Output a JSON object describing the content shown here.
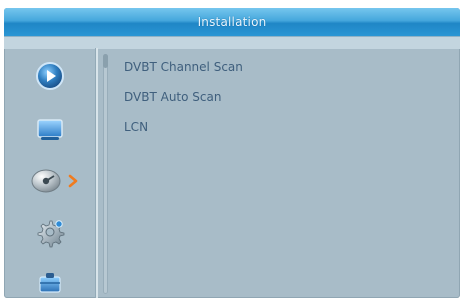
{
  "title": "Installation",
  "sidebar": {
    "items": [
      {
        "icon": "media-play-icon"
      },
      {
        "icon": "tv-monitor-icon"
      },
      {
        "icon": "satellite-disc-icon",
        "selected": true
      },
      {
        "icon": "gear-icon"
      },
      {
        "icon": "briefcase-icon"
      }
    ]
  },
  "options": [
    {
      "label": "DVBT Channel Scan"
    },
    {
      "label": "DVBT Auto Scan"
    },
    {
      "label": "LCN"
    }
  ],
  "colors": {
    "title_bar": "#2a96d4",
    "panel_bg": "#a8bcc8",
    "text": "#3f5f7d",
    "arrow": "#f07b1f"
  }
}
